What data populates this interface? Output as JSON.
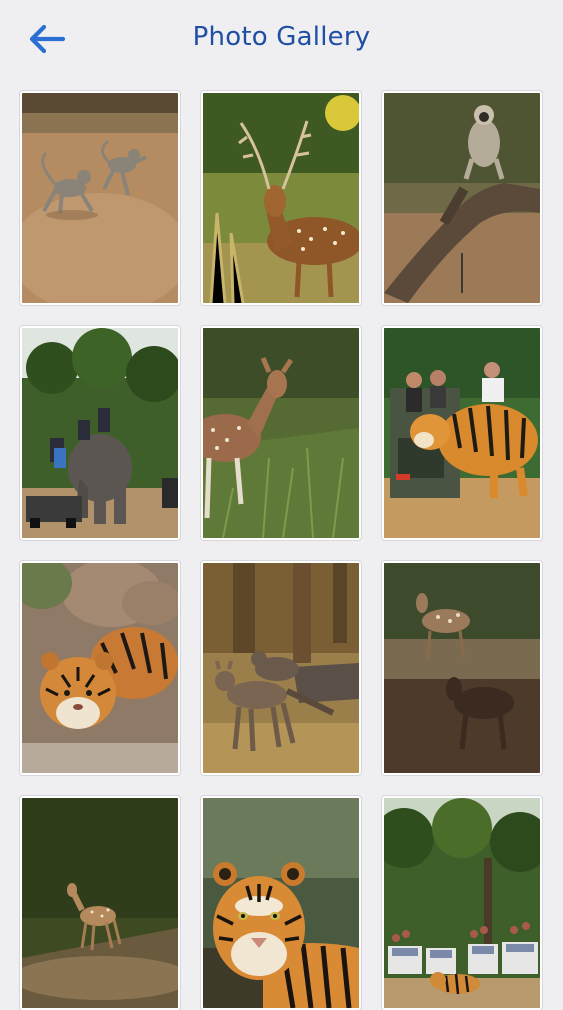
{
  "header": {
    "title": "Photo Gallery",
    "back_icon": "arrow-left-icon"
  },
  "colors": {
    "accent": "#1f4ea3",
    "back_arrow": "#2a6fd1",
    "background": "#efeff2"
  },
  "gallery": {
    "photos": [
      {
        "subject": "langur-monkeys-on-dirt-road"
      },
      {
        "subject": "spotted-deer-stag"
      },
      {
        "subject": "langur-on-tree-branch"
      },
      {
        "subject": "elephant-safari-with-jeeps"
      },
      {
        "subject": "spotted-deer-in-grass"
      },
      {
        "subject": "tiger-near-safari-jeep"
      },
      {
        "subject": "tiger-among-rocks"
      },
      {
        "subject": "wild-dogs-in-forest"
      },
      {
        "subject": "spotted-deer-herd"
      },
      {
        "subject": "spotted-deer-on-slope"
      },
      {
        "subject": "tiger-portrait"
      },
      {
        "subject": "tiger-crossing-jeep-track"
      }
    ]
  }
}
